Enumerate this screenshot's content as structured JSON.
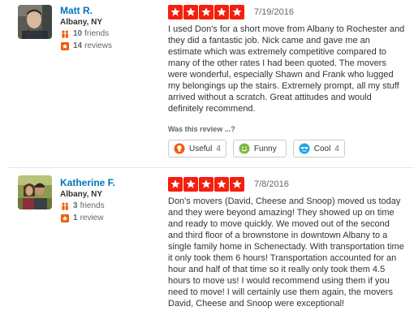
{
  "colors": {
    "link": "#0073bb",
    "star": "#f41f0e",
    "friends_icon": "#f15c00",
    "reviews_icon": "#f15c00",
    "useful_icon": "#f15c00",
    "funny_icon": "#7eb942",
    "cool_icon": "#1fa5e3"
  },
  "icons": {
    "friends": "friends-icon",
    "reviews": "star-badge-icon",
    "star": "star-icon",
    "useful": "lightbulb-icon",
    "funny": "smiley-icon",
    "cool": "sunglasses-icon"
  },
  "reviews": [
    {
      "user": {
        "name": "Matt R.",
        "location": "Albany, NY",
        "friends_count": "10",
        "friends_label": "friends",
        "reviews_count": "14",
        "reviews_label": "reviews"
      },
      "rating": 5,
      "date": "7/19/2016",
      "text": "I used Don's for a short move from Albany to Rochester and they did a fantastic job.  Nick came and gave me an estimate which was extremely competitive compared to many of the other rates I had been quoted.  The movers were wonderful, especially Shawn and Frank who lugged my belongings up the stairs.  Extremely prompt, all my stuff arrived without a scratch.  Great attitudes and would definitely recommend.",
      "helpful_prompt": "Was this review ...?",
      "votes": {
        "useful": {
          "label": "Useful",
          "count": "4"
        },
        "funny": {
          "label": "Funny",
          "count": ""
        },
        "cool": {
          "label": "Cool",
          "count": "4"
        }
      }
    },
    {
      "user": {
        "name": "Katherine F.",
        "location": "Albany, NY",
        "friends_count": "3",
        "friends_label": "friends",
        "reviews_count": "1",
        "reviews_label": "review"
      },
      "rating": 5,
      "date": "7/8/2016",
      "text": "Don's movers (David, Cheese and Snoop) moved us today and they were beyond amazing! They showed up on time and ready to move quickly. We moved out of the second and third floor of a brownstone in downtown Albany to a single family home in Schenectady. With transportation time it only took them 6 hours! Transportation accounted for an hour and half of that time so it really only took them 4.5 hours to move us! I would recommend using them if you need to move! I will certainly use them again, the movers David, Cheese and Snoop were exceptional!"
    }
  ]
}
